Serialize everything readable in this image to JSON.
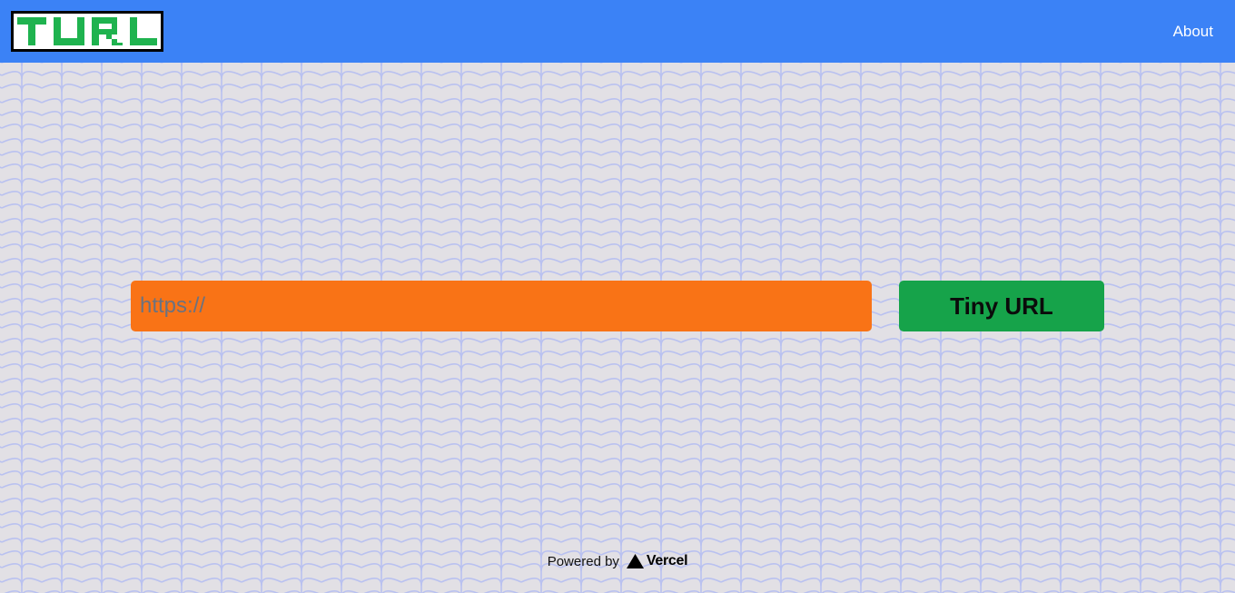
{
  "header": {
    "logo_text": "TURL",
    "about_label": "About"
  },
  "form": {
    "url_placeholder": "https://",
    "url_value": "",
    "submit_label": "Tiny URL"
  },
  "footer": {
    "powered_by_label": "Powered by",
    "vercel_label": "Vercel",
    "vercel_icon": "vercel-triangle-icon"
  },
  "colors": {
    "header_bg": "#3b82f6",
    "page_bg": "#e2e0e5",
    "pattern_stroke": "#b9c1f0",
    "input_bg": "#f97316",
    "button_bg": "#16a34a",
    "logo_green": "#1fb34f"
  }
}
